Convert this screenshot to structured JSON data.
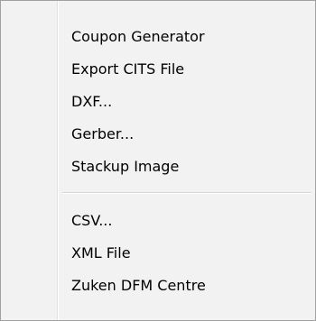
{
  "menu": {
    "group1": [
      {
        "label": "Coupon Generator"
      },
      {
        "label": "Export CITS File"
      },
      {
        "label": "DXF..."
      },
      {
        "label": "Gerber..."
      },
      {
        "label": "Stackup Image"
      }
    ],
    "group2": [
      {
        "label": "CSV..."
      },
      {
        "label": "XML File"
      },
      {
        "label": "Zuken DFM Centre"
      }
    ]
  }
}
